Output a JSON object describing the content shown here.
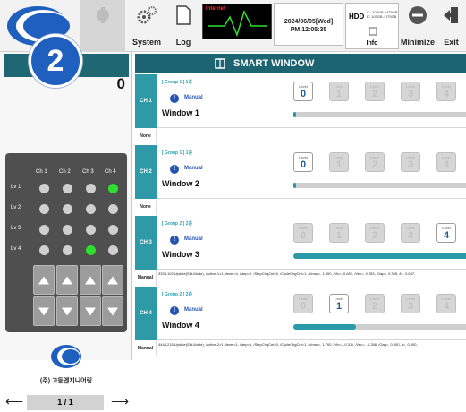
{
  "toolbar": {
    "system_label": "System",
    "log_label": "Log",
    "internet_label": "Internet",
    "date": "2024/06/05[Wed]",
    "time": "PM 12:05:35",
    "hdd_label": "HDD",
    "hdd_c": "C : 103GB / 475GB",
    "hdd_d": "D: 103GB / 475GB",
    "info_label": "Info",
    "minimize_label": "Minimize",
    "exit_label": "Exit"
  },
  "left": {
    "badge": "2",
    "value": "0",
    "channels": [
      "Ch 1",
      "Ch 2",
      "Ch 3",
      "Ch 4"
    ],
    "levels": [
      "Lv 1",
      "Lv 2",
      "Lv 3",
      "Lv 4"
    ],
    "company": "(주) 고등엔지니어링",
    "page": "1 / 1"
  },
  "main": {
    "title": "SMART WINDOW",
    "windows": [
      {
        "ch": "CH 1",
        "group": "[ Group 1 ] 1층",
        "mode": "Manual",
        "name": "Window 1",
        "level": 0,
        "progress": 0.01,
        "status_tag": "None",
        "status": ""
      },
      {
        "ch": "CH 2",
        "group": "[ Group 1 ] 1층",
        "mode": "Manual",
        "name": "Window 2",
        "level": 0,
        "progress": 0.01,
        "status_tag": "None",
        "status": ""
      },
      {
        "ch": "CH 3",
        "group": "[ Group 2 ] 2층",
        "mode": "Manual",
        "name": "Window 3",
        "level": 4,
        "progress": 1.0,
        "status_tag": "Manual",
        "status": "3333,102,Update(Std-Mode), /active-1>1, /level=4, /step=2, /StepChgCnt=0, /CycleChgCnt=1, /Vmax=, 1.800, /Vin=, 0.653, /Vec=, 0.783, /Gap=, 0.395, /t=, 0.047,"
      },
      {
        "ch": "CH 4",
        "group": "[ Group 2 ] 2층",
        "mode": "Manual",
        "name": "Window 4",
        "level": 1,
        "progress": 0.35,
        "status_tag": "Manual",
        "status": "4444,215,Update(Std-Mode), /active-2>1, /level=1, /step=1, /StepChgCnt=0, /CycleChgCnt=1, /Vmax=, 1.700, /Vin=, -0.311, /Vec=, -0.288, /Gap=, 0.000, /t=, 0.000,"
      }
    ],
    "level_label": "Level"
  },
  "colors": {
    "teal_dark": "#1c6471",
    "teal": "#2f9aa7",
    "badge_blue": "#1f5fbd",
    "indicator_on": "#2ee02e"
  }
}
